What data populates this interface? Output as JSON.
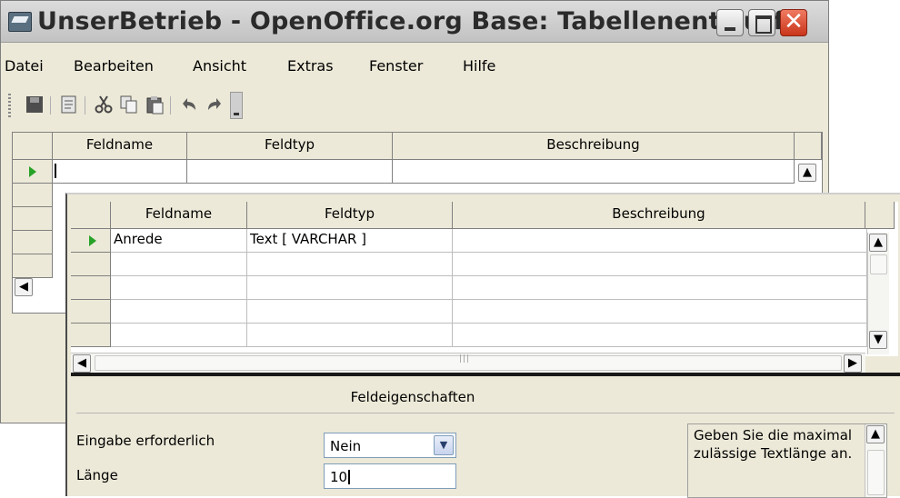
{
  "window": {
    "title": "UnserBetrieb - OpenOffice.org Base: Tabellenentwurf",
    "close_glyph": "✕"
  },
  "menu": [
    {
      "label": "Datei"
    },
    {
      "label": "Bearbeiten"
    },
    {
      "label": "Ansicht"
    },
    {
      "label": "Extras"
    },
    {
      "label": "Fenster"
    },
    {
      "label": "Hilfe"
    }
  ],
  "toolbar": {
    "icons": [
      "save-icon",
      "edit-icon",
      "cut-icon",
      "copy-icon",
      "paste-icon",
      "undo-icon",
      "redo-icon",
      "more-icon"
    ]
  },
  "back_table": {
    "columns": [
      "Feldname",
      "Feldtyp",
      "Beschreibung"
    ]
  },
  "front_table": {
    "columns": [
      "Feldname",
      "Feldtyp",
      "Beschreibung"
    ],
    "rows": [
      {
        "feldname": "Anrede",
        "feldtyp": "Text [ VARCHAR ]",
        "beschreibung": ""
      },
      {
        "feldname": "",
        "feldtyp": "",
        "beschreibung": ""
      },
      {
        "feldname": "",
        "feldtyp": "",
        "beschreibung": ""
      },
      {
        "feldname": "",
        "feldtyp": "",
        "beschreibung": ""
      },
      {
        "feldname": "",
        "feldtyp": "",
        "beschreibung": ""
      }
    ]
  },
  "properties": {
    "title": "Feldeigenschaften",
    "required_label": "Eingabe erforderlich",
    "required_value": "Nein",
    "length_label": "Länge",
    "length_value": "10",
    "help_text": "Geben Sie die maximal zulässige Textlänge an."
  },
  "colors": {
    "chrome": "#ece9d8",
    "row_marker": "#27a327",
    "close_button": "#c9351a"
  }
}
